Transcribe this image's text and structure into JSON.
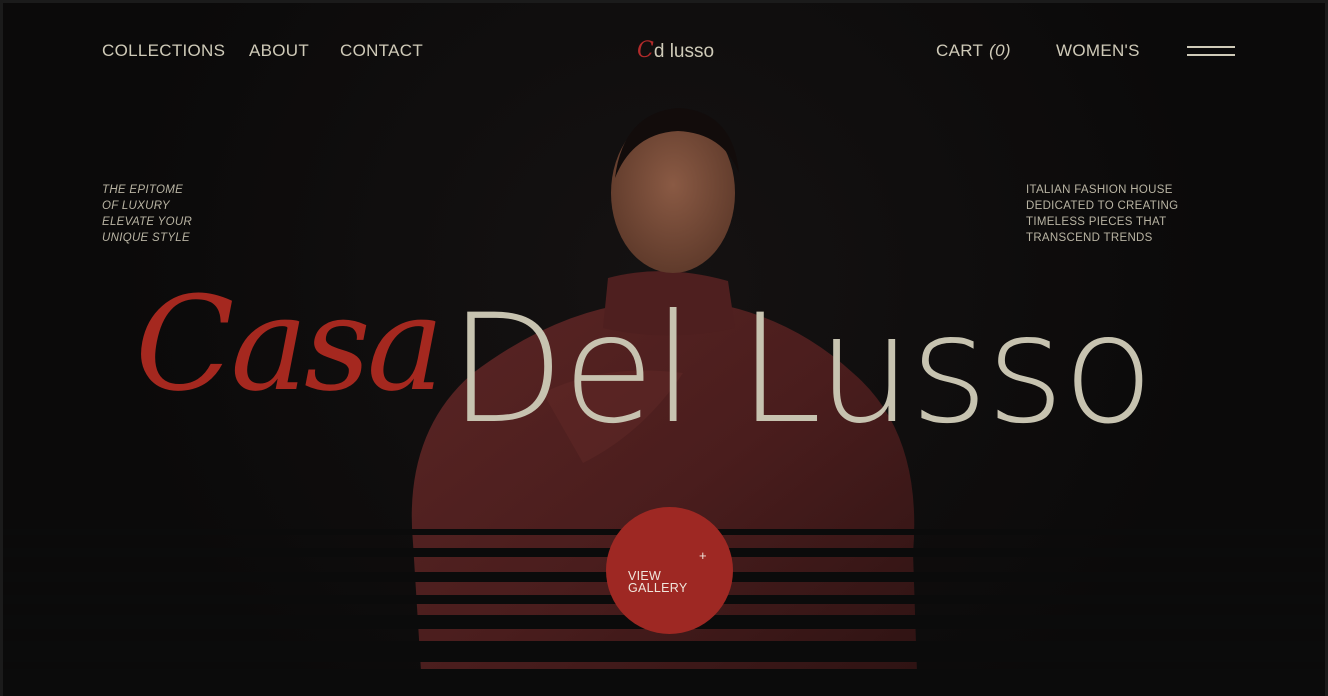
{
  "nav": {
    "collections": "COLLECTIONS",
    "about": "ABOUT",
    "contact": "CONTACT",
    "cart_label": "CART",
    "cart_count": "(0)",
    "womens": "WOMEN'S"
  },
  "logo": {
    "mark": "C",
    "text": "d lusso"
  },
  "tagline_left": [
    "THE EPITOME",
    "OF LUXURY",
    "ELEVATE YOUR",
    "UNIQUE STYLE"
  ],
  "tagline_right": [
    "ITALIAN FASHION HOUSE",
    "DEDICATED TO CREATING",
    "TIMELESS PIECES THAT",
    "TRANSCEND TRENDS"
  ],
  "headline": {
    "script": "Casa",
    "sans": "Del Lusso"
  },
  "gallery_button": {
    "plus": "+",
    "line1": "VIEW",
    "line2": "GALLERY"
  },
  "colors": {
    "accent": "#a5281f",
    "text": "#c7c3b0",
    "background": "#0d0b0b"
  }
}
